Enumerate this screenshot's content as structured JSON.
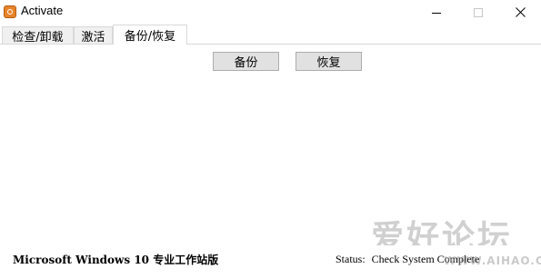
{
  "window": {
    "title": "Activate",
    "controls": [
      "minimize-icon",
      "maximize-icon",
      "close-icon"
    ]
  },
  "tabs": [
    {
      "label": "检查/卸载",
      "active": false
    },
    {
      "label": "激活",
      "active": false
    },
    {
      "label": "备份/恢复",
      "active": true
    }
  ],
  "actions": {
    "backup_label": "备份",
    "restore_label": "恢复"
  },
  "statusbar": {
    "os_name": "Microsoft Windows 10 专业工作站版",
    "status_label": "Status:",
    "status_value": "Check System Complete"
  },
  "watermark": {
    "text": "爱好论坛",
    "url": "WWW.AIHAO.CC"
  },
  "colors": {
    "app_icon": "#e8832a",
    "button_bg": "#e1e1e1",
    "button_border": "#adadad",
    "tab_border": "#d9d9d9"
  }
}
